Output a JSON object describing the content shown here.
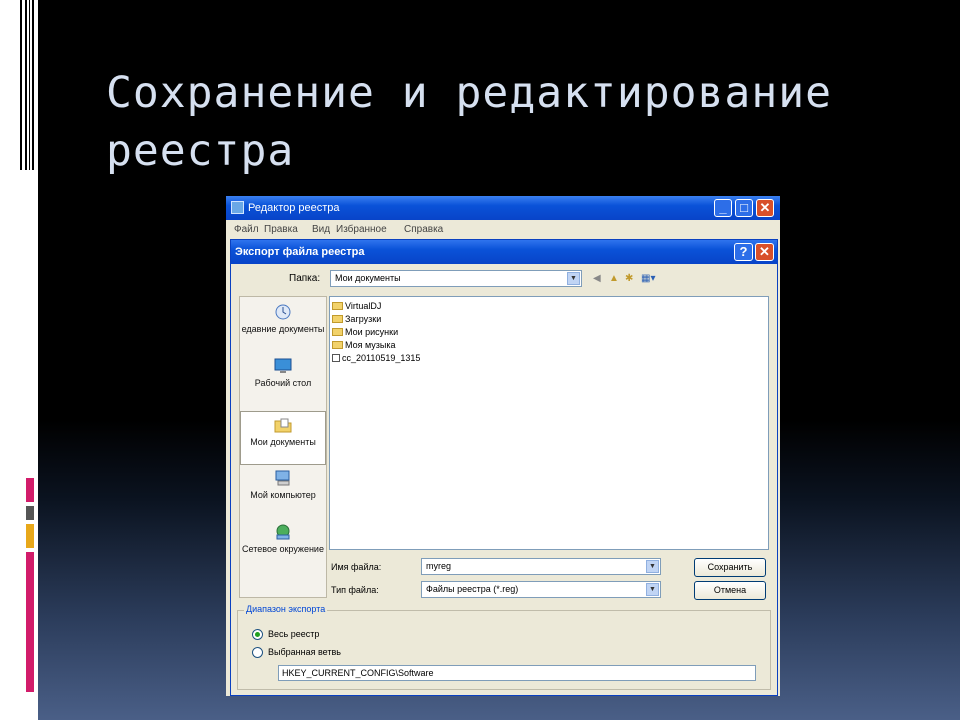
{
  "slide": {
    "title": "Сохранение и редактирование реестра"
  },
  "window": {
    "title": "Редактор реестра",
    "min": "_",
    "max": "□",
    "close": "✕",
    "menu": [
      "Файл",
      "Правка",
      "Вид",
      "Избранное",
      "Справка"
    ]
  },
  "dialog": {
    "title": "Экспорт файла реестра",
    "help": "?",
    "close": "✕",
    "folder_label": "Папка:",
    "folder_value": "Мои документы",
    "places": [
      {
        "label": "едавние документы",
        "icon": "recent-documents-icon"
      },
      {
        "label": "Рабочий стол",
        "icon": "desktop-icon"
      },
      {
        "label": "Мои документы",
        "icon": "my-documents-icon"
      },
      {
        "label": "Мой компьютер",
        "icon": "my-computer-icon"
      },
      {
        "label": "Сетевое окружение",
        "icon": "network-icon"
      }
    ],
    "files": [
      {
        "name": "VirtualDJ",
        "type": "folder"
      },
      {
        "name": "Загрузки",
        "type": "folder"
      },
      {
        "name": "Мои рисунки",
        "type": "folder"
      },
      {
        "name": "Моя музыка",
        "type": "folder"
      },
      {
        "name": "cc_20110519_1315",
        "type": "reg"
      }
    ],
    "filename_label": "Имя файла:",
    "filename_value": "myreg",
    "filetype_label": "Тип файла:",
    "filetype_value": "Файлы реестра (*.reg)",
    "save_button": "Сохранить",
    "cancel_button": "Отмена",
    "range_group": "Диапазон экспорта",
    "radio_all": "Весь реестр",
    "radio_branch": "Выбранная ветвь",
    "branch_value": "HKEY_CURRENT_CONFIG\\Software",
    "selected_radio": "all"
  }
}
